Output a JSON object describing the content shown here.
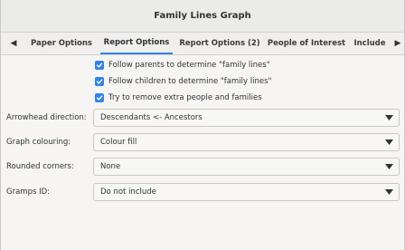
{
  "window": {
    "title": "Family Lines Graph"
  },
  "tabs": [
    {
      "label": "Paper Options"
    },
    {
      "label": "Report Options"
    },
    {
      "label": "Report Options (2)"
    },
    {
      "label": "People of Interest"
    },
    {
      "label": "Include"
    }
  ],
  "active_tab": "Report Options",
  "checkboxes": [
    {
      "label": "Follow parents to determine \"family lines\"",
      "checked": true
    },
    {
      "label": "Follow children to determine \"family lines\"",
      "checked": true
    },
    {
      "label": "Try to remove extra people and families",
      "checked": true
    }
  ],
  "fields": [
    {
      "label": "Arrowhead direction:",
      "value": "Descendants <- Ancestors"
    },
    {
      "label": "Graph colouring:",
      "value": "Colour fill"
    },
    {
      "label": "Rounded corners:",
      "value": "None"
    },
    {
      "label": "Gramps ID:",
      "value": "Do not include"
    }
  ],
  "colors": {
    "accent": "#3584e4",
    "background": "#f6f5f4"
  }
}
